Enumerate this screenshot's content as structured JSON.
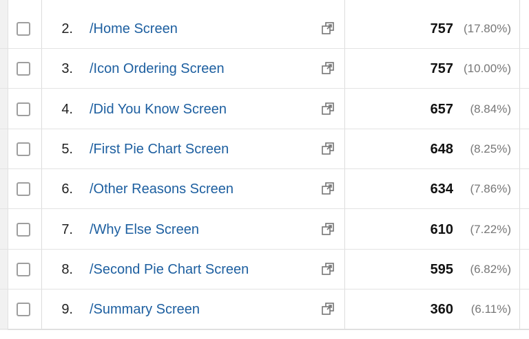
{
  "rows": [
    {
      "index": "2.",
      "page": "/Home Screen",
      "views": "757",
      "percent": "(17.80%)"
    },
    {
      "index": "3.",
      "page": "/Icon Ordering Screen",
      "views": "757",
      "percent": "(10.00%)"
    },
    {
      "index": "4.",
      "page": "/Did You Know Screen",
      "views": "657",
      "percent": "(8.84%)"
    },
    {
      "index": "5.",
      "page": "/First Pie Chart Screen",
      "views": "648",
      "percent": "(8.25%)"
    },
    {
      "index": "6.",
      "page": "/Other Reasons Screen",
      "views": "634",
      "percent": "(7.86%)"
    },
    {
      "index": "7.",
      "page": "/Why Else Screen",
      "views": "610",
      "percent": "(7.22%)"
    },
    {
      "index": "8.",
      "page": "/Second Pie Chart Screen",
      "views": "595",
      "percent": "(6.82%)"
    },
    {
      "index": "9.",
      "page": "/Summary Screen",
      "views": "360",
      "percent": "(6.11%)"
    }
  ],
  "icons": {
    "row_action": "open-in-new-window-icon"
  },
  "colors": {
    "link": "#1d5fa0",
    "grid": "#dcdcdc"
  }
}
